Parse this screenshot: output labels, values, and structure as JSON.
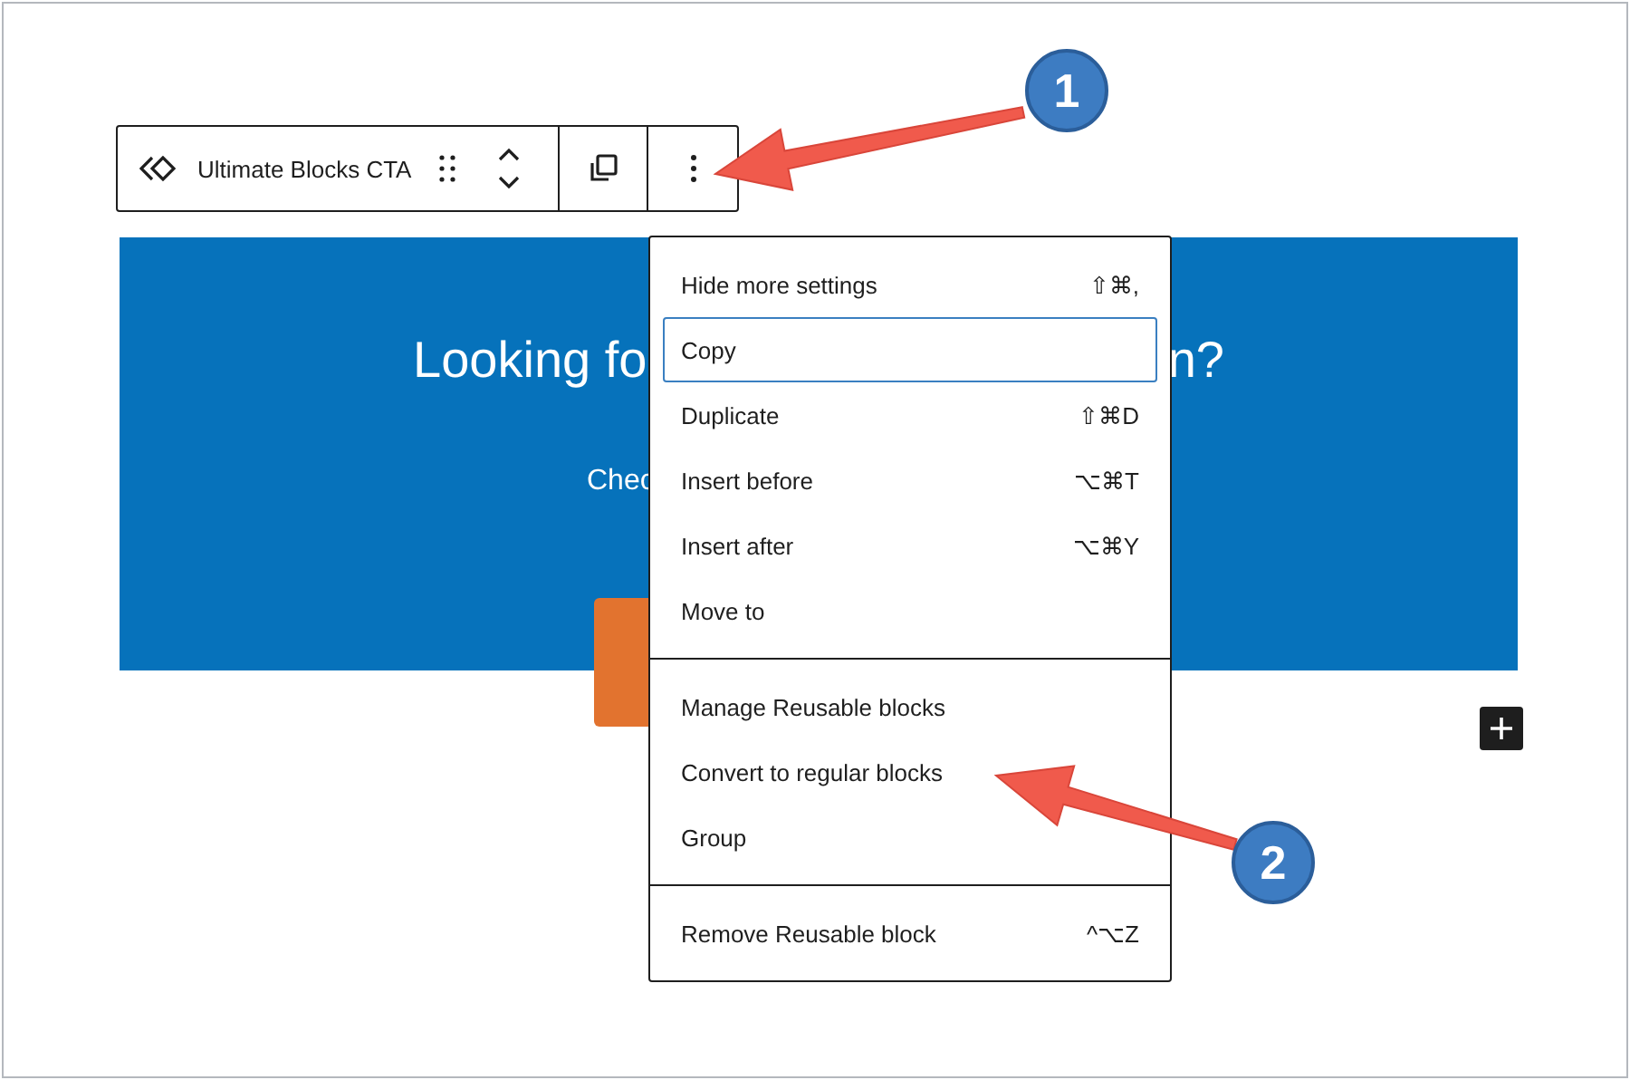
{
  "toolbar": {
    "block_label": "Ultimate Blocks CTA"
  },
  "banner": {
    "heading_start": "Looking fo",
    "heading_end": "n?",
    "text_start": "Chec"
  },
  "menu": {
    "groups": [
      [
        {
          "label": "Hide more settings",
          "shortcut": "⇧⌘,",
          "focused": false
        },
        {
          "label": "Copy",
          "focused": true
        },
        {
          "label": "Duplicate",
          "shortcut": "⇧⌘D",
          "focused": false
        },
        {
          "label": "Insert before",
          "shortcut": "⌥⌘T",
          "focused": false
        },
        {
          "label": "Insert after",
          "shortcut": "⌥⌘Y",
          "focused": false
        },
        {
          "label": "Move to",
          "focused": false
        }
      ],
      [
        {
          "label": "Manage Reusable blocks",
          "focused": false
        },
        {
          "label": "Convert to regular blocks",
          "focused": false
        },
        {
          "label": "Group",
          "focused": false
        }
      ],
      [
        {
          "label": "Remove Reusable block",
          "shortcut": "^⌥Z",
          "focused": false
        }
      ]
    ]
  },
  "callouts": [
    {
      "number": "1"
    },
    {
      "number": "2"
    }
  ]
}
